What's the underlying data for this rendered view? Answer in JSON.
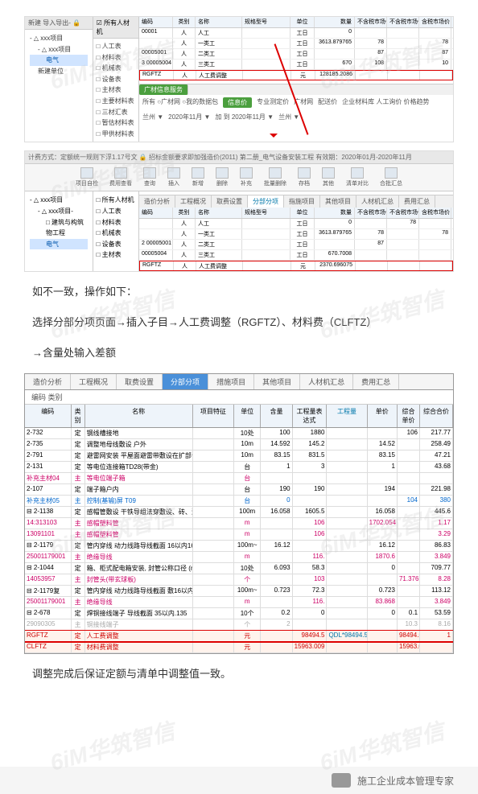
{
  "watermark_text": "6iM华筑智信",
  "scr1": {
    "toolbar": "新建  导入导出- 🔒",
    "tree": [
      {
        "label": "- △ xxx项目",
        "indent": 0
      },
      {
        "label": "- △ xxx项目",
        "indent": 1
      },
      {
        "label": "电气",
        "indent": 2,
        "selected": true
      },
      {
        "label": "新建单位",
        "indent": 1
      }
    ],
    "mid_header": "☑ 所有人材机",
    "mid_items": [
      "□ 人工表",
      "□ 材料表",
      "□ 机械表",
      "□ 设备表",
      "□ 主材表",
      "□ 主要材料表",
      "□ 三材汇表",
      "□ 暂估材料表",
      "□ 甲供材料表"
    ],
    "cols": [
      "编码",
      "类别",
      "名称",
      "规格型号",
      "单位",
      "数量",
      "不含税市场价",
      "不含税市场价合",
      "含税市场价",
      "税"
    ],
    "rows": [
      [
        "00001",
        "人",
        "人工",
        "",
        "工日",
        "0",
        "",
        "",
        ""
      ],
      [
        "",
        "人",
        "一类工",
        "",
        "工日",
        "3613.879765",
        "78",
        "",
        "78"
      ],
      [
        "00005001",
        "人",
        "二类工",
        "",
        "工日",
        "",
        "87",
        "",
        "87"
      ],
      [
        "3 00005004",
        "人",
        "三类工",
        "",
        "工日",
        "670",
        "108",
        "",
        "10"
      ],
      [
        "RGFTZ",
        "人",
        "人工费调整",
        "",
        "元",
        "128185.2086",
        "",
        "",
        ""
      ]
    ],
    "highlight_row": 4,
    "lower_tabs": [
      "广材信息服务"
    ],
    "filter_items": [
      "所有  ○广材网  ○我的数据包",
      "专业测定价",
      "广材网",
      "配送价",
      "企业材料库  人工询价  价格趋势"
    ],
    "greenbtn": "信息价",
    "region_filter": [
      "兰州 ▼",
      "2020年11月 ▼",
      "加    到  2020年11月 ▼",
      "兰州 ▼"
    ]
  },
  "scr2": {
    "breadcrumb": "计费方式：定额统一规则下浮1.17号文 🔒    招标金额要求即加强造价(2011)  第二册_电气设备安装工程    有效期：2020年01月-2020年11月",
    "ribbon": [
      "项目自检",
      "费用查看",
      "查询",
      "插入",
      "新增",
      "删除",
      "补充",
      "批量删除",
      "存档",
      "其他",
      "清单对比",
      "合批汇总"
    ],
    "tree": [
      {
        "label": "- △ xxx项目",
        "indent": 0
      },
      {
        "label": "- △ xxx项目-",
        "indent": 1
      },
      {
        "label": "□ 建筑与构筑物工程",
        "indent": 2
      },
      {
        "label": "电气",
        "indent": 2,
        "selected": true
      }
    ],
    "mid_items": [
      "□ 所有人材机",
      "□ 人工表",
      "□ 材料表",
      "□ 机械表",
      "□ 设备表",
      "□ 主材表"
    ],
    "grid_tabs": [
      "造价分析",
      "工程概况",
      "取费设置",
      "分部分项",
      "指施项目",
      "其他项目",
      "人材机汇总",
      "费用汇总"
    ],
    "active_tab": 3,
    "cols": [
      "编码",
      "类别",
      "名称",
      "规格型号",
      "单位",
      "数量",
      "不含税市场价",
      "不含税市场价合",
      "含税市场价",
      "税率"
    ],
    "rows": [
      [
        "",
        "人",
        "人工",
        "",
        "工日",
        "0",
        "",
        "78",
        ""
      ],
      [
        "",
        "人",
        "一类工",
        "",
        "工日",
        "3613.879765",
        "78",
        "",
        "78"
      ],
      [
        "2 00005001",
        "人",
        "二类工",
        "",
        "工日",
        "",
        "87",
        "",
        ""
      ],
      [
        "00005004",
        "人",
        "三类工",
        "",
        "工日",
        "670.7008",
        "",
        "",
        ""
      ],
      [
        "RGFTZ",
        "人",
        "人工费调整",
        "",
        "元",
        "2370.696075",
        "",
        "",
        ""
      ]
    ],
    "highlight_row": 4
  },
  "instructions": {
    "p1": "如不一致，操作如下：",
    "p2": "选择分部分项页面→插入子目→人工费调整（RGFTZ）、材料费（CLFTZ）",
    "p3": "→含量处输入差额"
  },
  "bigtable": {
    "tabs": [
      "造价分析",
      "工程概况",
      "取费设置",
      "分部分项",
      "措施项目",
      "其他项目",
      "人材机汇总",
      "费用汇总"
    ],
    "active_tab": 3,
    "subhdr": "   编码      类别",
    "cols": [
      "编码",
      "类别",
      "名称",
      "项目特征",
      "单位",
      "含量",
      "工程量表达式",
      "工程量",
      "单价",
      "综合单价",
      "综合合价"
    ],
    "rows": [
      {
        "code": "2-732",
        "type": "定",
        "name": "钢线槽接地",
        "unit": "10处",
        "amt": "100",
        "qty": "1880",
        "expr": "",
        "eng": "",
        "sum": "106",
        "tot": "217.77"
      },
      {
        "code": "2-735",
        "type": "定",
        "name": "调整地母线敷设 户外",
        "unit": "10m",
        "amt": "14.592",
        "qty": "145.2",
        "expr": "",
        "eng": "14.52",
        "sum": "",
        "tot": "258.49"
      },
      {
        "code": "2-791",
        "type": "定",
        "name": "避雷网安装 平屋面避雷带敷设在扩部设",
        "unit": "10m",
        "amt": "83.15",
        "qty": "831.5",
        "expr": "",
        "eng": "83.15",
        "sum": "",
        "tot": "47.21"
      },
      {
        "code": "2-131",
        "type": "定",
        "name": "等电位连接箱TD28(带金)",
        "unit": "台",
        "amt": "1",
        "qty": "3",
        "expr": "",
        "eng": "1",
        "sum": "",
        "tot": "43.68"
      },
      {
        "code": "补充主材04",
        "type": "主",
        "name": "等电位端子箱",
        "unit": "台",
        "amt": "",
        "qty": "",
        "expr": "",
        "eng": "",
        "sum": "",
        "tot": "",
        "cls": "row-pink"
      },
      {
        "code": "2-107",
        "type": "定",
        "name": "端子箱户内",
        "unit": "台",
        "amt": "190",
        "qty": "190",
        "expr": "",
        "eng": "194",
        "sum": "",
        "tot": "221.98"
      },
      {
        "code": "补充主材05",
        "type": "主",
        "name": "控制(基输)屏 T09",
        "unit": "台",
        "amt": "0",
        "qty": "",
        "expr": "",
        "eng": "",
        "sum": "104",
        "tot": "380",
        "cls": "row-blue"
      },
      {
        "code": "⊟ 2-1138",
        "type": "定",
        "name": "感帽管敷设 干铁导组法穿敷设、砖、混基土挂帐设打孔位 (孔尺寸09)",
        "unit": "100m",
        "amt": "16.058",
        "qty": "1605.5",
        "expr": "",
        "eng": "16.058",
        "sum": "",
        "tot": "445.6"
      },
      {
        "code": "14:313103",
        "type": "主",
        "name": "感帽塑料管",
        "unit": "m",
        "amt": "",
        "qty": "106",
        "expr": "",
        "eng": "1702.054",
        "sum": "",
        "tot": "1.17",
        "cls": "row-pink"
      },
      {
        "code": "13091101",
        "type": "主",
        "name": "感帽塑料管",
        "unit": "m",
        "amt": "",
        "qty": "106",
        "expr": "",
        "eng": "",
        "sum": "",
        "tot": "3.29",
        "cls": "row-pink"
      },
      {
        "code": "⊟ 2-1179",
        "type": "定",
        "name": "管内穿线 动力线路导线截面 16以内16",
        "unit": "100m~",
        "amt": "16.12",
        "qty": "",
        "expr": "",
        "eng": "16.12",
        "sum": "",
        "tot": "86.83"
      },
      {
        "code": "25001179001",
        "type": "主",
        "name": "绝缘导线",
        "unit": "m",
        "amt": "",
        "qty": "116.",
        "expr": "",
        "eng": "1870.6",
        "sum": "",
        "tot": "3.849",
        "cls": "row-pink"
      },
      {
        "code": "⊟ 2-1044",
        "type": "定",
        "name": "箱、柜式配电箱安装, 封管公称口径 (mm以内)100",
        "unit": "10处",
        "amt": "6.093",
        "qty": "58.3",
        "expr": "",
        "eng": "0",
        "sum": "",
        "tot": "709.77"
      },
      {
        "code": "14053957",
        "type": "主",
        "name": "封管头(带玄球板)",
        "unit": "个",
        "amt": "",
        "qty": "103",
        "expr": "",
        "eng": "",
        "sum": "71.376",
        "tot": "8.28",
        "cls": "row-pink"
      },
      {
        "code": "⊟ 2-1179复",
        "type": "定",
        "name": "管内穿线 动力线路导线截面 敷16以内135",
        "unit": "100m~",
        "amt": "0.723",
        "qty": "72.3",
        "expr": "",
        "eng": "0.723",
        "sum": "",
        "tot": "113.12"
      },
      {
        "code": "25001179001",
        "type": "主",
        "name": "绝缘导线",
        "unit": "m",
        "amt": "",
        "qty": "116.",
        "expr": "",
        "eng": "83.868",
        "sum": "",
        "tot": "3.849",
        "cls": "row-pink"
      },
      {
        "code": "⊟ 2-678",
        "type": "定",
        "name": "焊铜接线端子 导线截面 35以内.135",
        "unit": "10个",
        "amt": "0.2",
        "qty": "0",
        "expr": "",
        "eng": "0",
        "sum": "0.1",
        "tot": "53.59"
      },
      {
        "code": "29090305",
        "type": "主",
        "name": "铜接线端子",
        "unit": "个",
        "amt": "2",
        "qty": "",
        "expr": "",
        "eng": "",
        "sum": "10.3",
        "tot": "8.16",
        "cls": "row-light"
      },
      {
        "code": "RGFTZ",
        "type": "定",
        "name": "人工费调整",
        "unit": "元",
        "amt": "",
        "qty": "98494.5",
        "expr": "QDL*98494.5",
        "eng": "",
        "sum": "98494.5",
        "tot": "1",
        "cls": "row-red",
        "hl": true
      },
      {
        "code": "CLFTZ",
        "type": "定",
        "name": "材料费调整",
        "unit": "元",
        "amt": "",
        "qty": "15963.009",
        "expr": "",
        "eng": "",
        "sum": "15963.009",
        "tot": "",
        "cls": "row-red",
        "hl": true
      }
    ]
  },
  "instr2": "调整完成后保证定额与清单中调整值一致。",
  "footer": "施工企业成本管理专家"
}
